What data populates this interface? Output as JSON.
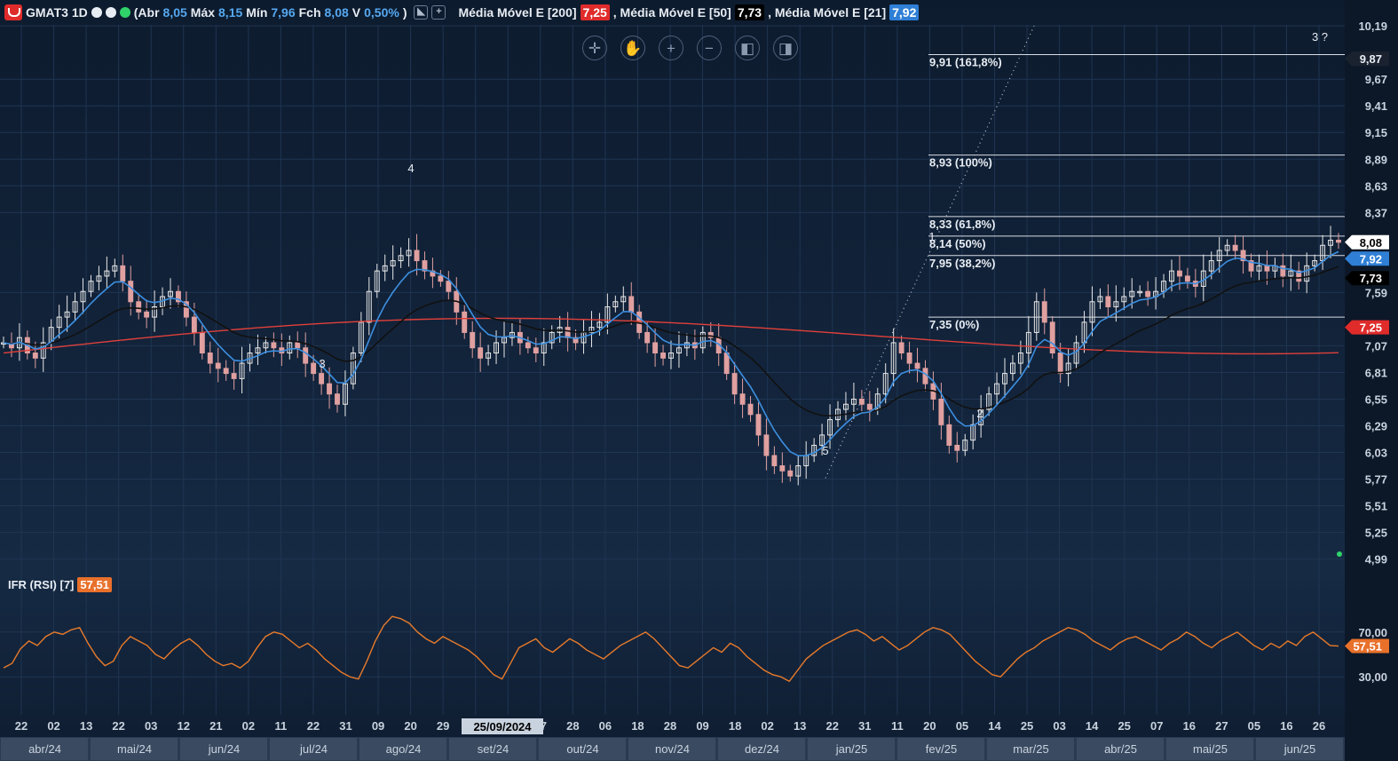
{
  "header": {
    "symbol": "GMAT3 1D",
    "open_label": "(Abr",
    "open": "8,05",
    "high_label": "Máx",
    "high": "8,15",
    "low_label": "Mín",
    "low": "7,96",
    "close_label": "Fch",
    "close": "8,08",
    "change_label": "V",
    "change": "0,50%",
    "close_paren": ")",
    "ma200_label": "Média Móvel E [200]",
    "ma200_value": "7,25",
    "ma50_label": ", Média Móvel E [50]",
    "ma50_value": "7,73",
    "ma21_label": ", Média Móvel E [21]",
    "ma21_value": "7,92",
    "btn_collapse": "◣",
    "btn_add": "+"
  },
  "toolbar": {
    "items": [
      "crosshair",
      "pan",
      "zoom-in",
      "zoom-out",
      "scroll-left",
      "scroll-right"
    ]
  },
  "rsi": {
    "label": "IFR (RSI) [7]",
    "value": "57,51",
    "ticks": [
      "70,00",
      "30,00"
    ]
  },
  "colors": {
    "ma200": "#e0403a",
    "ma50": "#111111",
    "ma21": "#3c8fe0",
    "rsi": "#e87a2a",
    "up": "#e8e8e8",
    "down": "#e0a0a0",
    "ma200_pill": "#e02b2b",
    "ma21_pill": "#2f7fd6",
    "rsi_pill": "#e8702a"
  },
  "chart_data": {
    "type": "candlestick",
    "y_ticks": [
      "10,19",
      "9,67",
      "9,41",
      "9,15",
      "8,89",
      "8,63",
      "8,37",
      "7,59",
      "7,07",
      "6,81",
      "6,55",
      "6,29",
      "6,03",
      "5,77",
      "5,51",
      "5,25",
      "4,99"
    ],
    "price_labels": [
      {
        "value": "9,87",
        "kind": "crosshair"
      },
      {
        "value": "8,08",
        "kind": "last"
      },
      {
        "value": "7,92",
        "kind": "ma21"
      },
      {
        "value": "7,73",
        "kind": "ma50"
      },
      {
        "value": "7,25",
        "kind": "ma200"
      }
    ],
    "fibonacci": [
      {
        "label": "9,91 (161,8%)",
        "value": 9.91
      },
      {
        "label": "8,93 (100%)",
        "value": 8.93
      },
      {
        "label": "8,33 (61,8%)",
        "value": 8.33
      },
      {
        "label": "8,14 (50%)",
        "value": 8.14
      },
      {
        "label": "7,95 (38,2%)",
        "value": 7.95
      },
      {
        "label": "7,35 (0%)",
        "value": 7.35
      }
    ],
    "wave_labels": [
      "4",
      "3",
      "5",
      "1",
      "2",
      "3 ?"
    ],
    "x_day_ticks": [
      "22",
      "02",
      "13",
      "22",
      "03",
      "12",
      "21",
      "02",
      "11",
      "22",
      "31",
      "09",
      "20",
      "29",
      "09",
      "8",
      "17",
      "28",
      "06",
      "18",
      "28",
      "09",
      "18",
      "02",
      "13",
      "22",
      "31",
      "11",
      "20",
      "05",
      "14",
      "25",
      "03",
      "14",
      "25",
      "07",
      "16",
      "27",
      "05",
      "16",
      "26"
    ],
    "x_month_ticks": [
      "abr/24",
      "mai/24",
      "jun/24",
      "jul/24",
      "ago/24",
      "set/24",
      "out/24",
      "nov/24",
      "dez/24",
      "jan/25",
      "fev/25",
      "mar/25",
      "abr/25",
      "mai/25",
      "jun/25"
    ],
    "cursor_date": "25/09/2024",
    "ylim": [
      4.9,
      10.2
    ],
    "close_series": [
      7.1,
      7.05,
      7.15,
      7.0,
      6.95,
      7.1,
      7.25,
      7.35,
      7.4,
      7.5,
      7.6,
      7.7,
      7.75,
      7.8,
      7.85,
      7.7,
      7.5,
      7.4,
      7.35,
      7.45,
      7.55,
      7.6,
      7.5,
      7.35,
      7.2,
      7.0,
      6.9,
      6.85,
      6.8,
      6.75,
      6.9,
      7.0,
      7.05,
      7.1,
      7.05,
      7.0,
      7.1,
      7.05,
      6.9,
      6.8,
      6.7,
      6.6,
      6.5,
      6.7,
      7.0,
      7.3,
      7.6,
      7.8,
      7.85,
      7.9,
      7.95,
      8.0,
      7.9,
      7.8,
      7.75,
      7.7,
      7.6,
      7.4,
      7.2,
      7.05,
      6.95,
      7.0,
      7.1,
      7.15,
      7.2,
      7.1,
      7.05,
      7.0,
      7.1,
      7.2,
      7.25,
      7.15,
      7.1,
      7.2,
      7.25,
      7.3,
      7.45,
      7.5,
      7.55,
      7.4,
      7.2,
      7.1,
      7.0,
      6.95,
      7.0,
      7.05,
      7.1,
      7.05,
      7.2,
      7.15,
      7.0,
      6.8,
      6.6,
      6.5,
      6.4,
      6.2,
      6.0,
      5.9,
      5.85,
      5.8,
      5.9,
      6.0,
      6.1,
      6.2,
      6.35,
      6.45,
      6.5,
      6.55,
      6.5,
      6.45,
      6.6,
      6.8,
      7.1,
      7.0,
      6.9,
      6.85,
      6.7,
      6.55,
      6.3,
      6.1,
      6.05,
      6.15,
      6.3,
      6.45,
      6.6,
      6.7,
      6.8,
      6.9,
      7.0,
      7.2,
      7.5,
      7.3,
      7.0,
      6.8,
      6.9,
      7.1,
      7.3,
      7.5,
      7.55,
      7.45,
      7.5,
      7.55,
      7.6,
      7.6,
      7.55,
      7.6,
      7.7,
      7.8,
      7.75,
      7.7,
      7.65,
      7.8,
      7.9,
      8.0,
      8.05,
      8.0,
      7.9,
      7.8,
      7.85,
      7.8,
      7.85,
      7.75,
      7.8,
      7.7,
      7.85,
      7.9,
      8.05,
      8.1,
      8.08
    ],
    "rsi_series": [
      38,
      42,
      55,
      62,
      58,
      66,
      70,
      68,
      72,
      74,
      60,
      48,
      40,
      44,
      58,
      66,
      62,
      58,
      50,
      46,
      54,
      60,
      64,
      58,
      50,
      44,
      40,
      42,
      38,
      44,
      56,
      66,
      70,
      68,
      62,
      56,
      60,
      54,
      46,
      40,
      34,
      30,
      28,
      44,
      62,
      76,
      84,
      82,
      78,
      70,
      64,
      60,
      66,
      62,
      58,
      54,
      48,
      40,
      32,
      28,
      42,
      56,
      60,
      64,
      56,
      52,
      58,
      64,
      60,
      54,
      50,
      46,
      52,
      58,
      62,
      66,
      70,
      64,
      56,
      48,
      40,
      38,
      44,
      50,
      56,
      52,
      60,
      56,
      48,
      42,
      36,
      32,
      30,
      26,
      36,
      46,
      52,
      58,
      62,
      66,
      70,
      72,
      68,
      62,
      66,
      60,
      54,
      58,
      64,
      70,
      74,
      72,
      68,
      60,
      52,
      44,
      38,
      32,
      30,
      38,
      46,
      52,
      56,
      62,
      66,
      70,
      74,
      72,
      68,
      62,
      58,
      54,
      60,
      64,
      66,
      62,
      58,
      54,
      60,
      64,
      70,
      66,
      60,
      56,
      62,
      66,
      70,
      64,
      58,
      54,
      60,
      56,
      62,
      58,
      66,
      70,
      64,
      58,
      57.5
    ]
  }
}
